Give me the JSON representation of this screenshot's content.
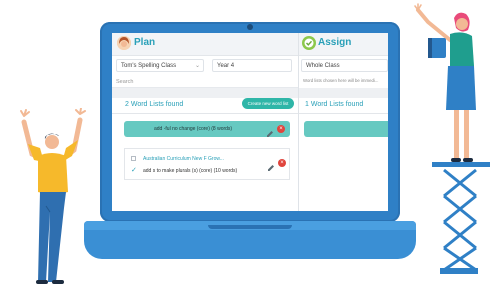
{
  "plan_panel": {
    "title": "Plan",
    "class_select": "Tom's Spelling Class",
    "year_select": "Year 4",
    "search_placeholder": "Search",
    "found_label": "2 Word Lists found",
    "create_button": "Create new word list",
    "selected_list": "add -ful no change (core) (8 words)",
    "list_source": "Australian Curriculum New F Grow...",
    "list_item": "add s to make plurals (s) (core) (10 words)"
  },
  "assign_panel": {
    "title": "Assign",
    "class_select": "Whole Class",
    "note": "Word lists chosen here will be immedi...",
    "found_label": "1 Word Lists found"
  },
  "colors": {
    "laptop_blue": "#2f80c6",
    "teal_accent": "#2aa0b8",
    "card_teal": "#66c9c1",
    "delete_red": "#e0453d"
  }
}
